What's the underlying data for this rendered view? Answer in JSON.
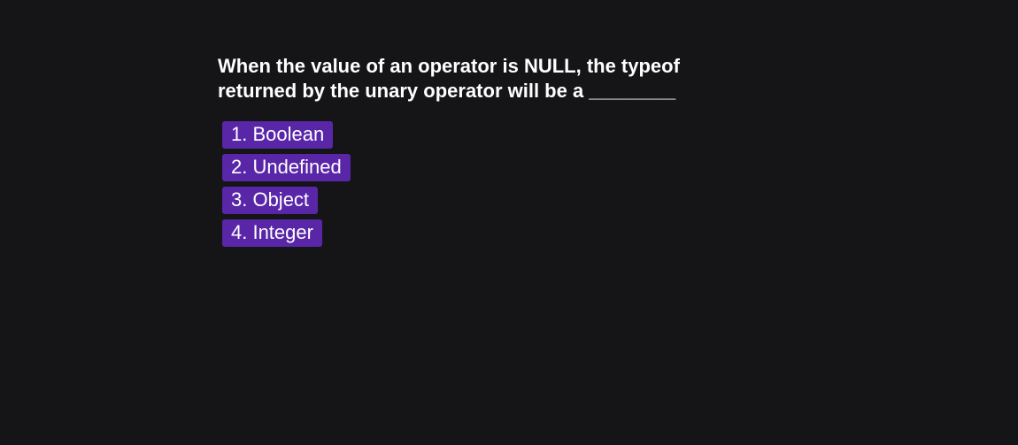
{
  "question": {
    "text": "When the value of an operator is NULL, the typeof returned by the unary operator will be a ________"
  },
  "options": [
    {
      "label": "1. Boolean"
    },
    {
      "label": "2. Undefined"
    },
    {
      "label": "3. Object"
    },
    {
      "label": "4. Integer"
    }
  ],
  "colors": {
    "background": "#151517",
    "option_background": "#5926a8",
    "text": "#ffffff"
  }
}
